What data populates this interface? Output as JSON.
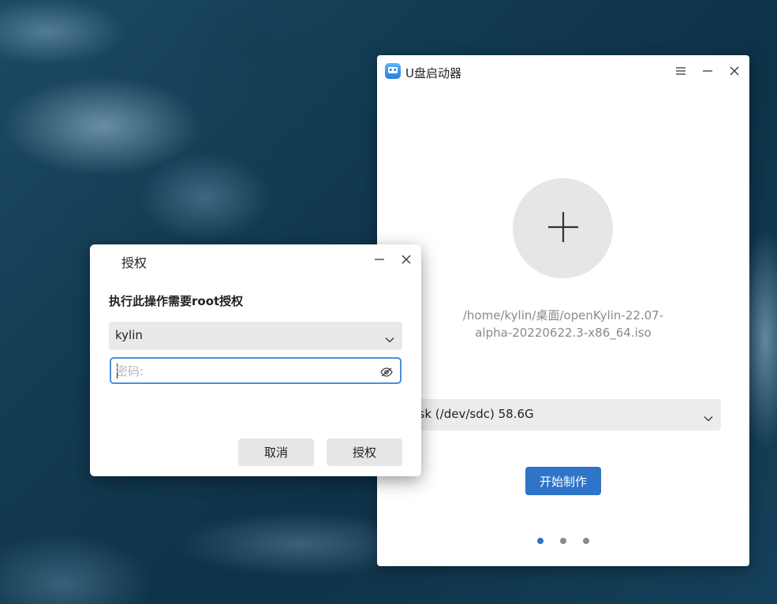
{
  "app": {
    "title": "U盘启动器",
    "iso_path_line1": "/home/kylin/桌面/openKylin-22.07-",
    "iso_path_line2": "alpha-20220622.3-x86_64.iso",
    "device_value": "Flash_Disk (/dev/sdc) 58.6G",
    "start_label": "开始制作",
    "page_indicator": {
      "total": 3,
      "current": 1
    }
  },
  "dialog": {
    "title": "授权",
    "message": "执行此操作需要root授权",
    "user_value": "kylin",
    "password_placeholder": "密码:",
    "cancel_label": "取消",
    "authorize_label": "授权"
  },
  "colors": {
    "accent": "#2e74c8",
    "focus_border": "#4a90d9"
  },
  "icons": [
    "app-logo-icon",
    "menu-icon",
    "minimize-icon",
    "close-icon",
    "plus-icon",
    "chevron-down-icon",
    "eye-hidden-icon"
  ]
}
